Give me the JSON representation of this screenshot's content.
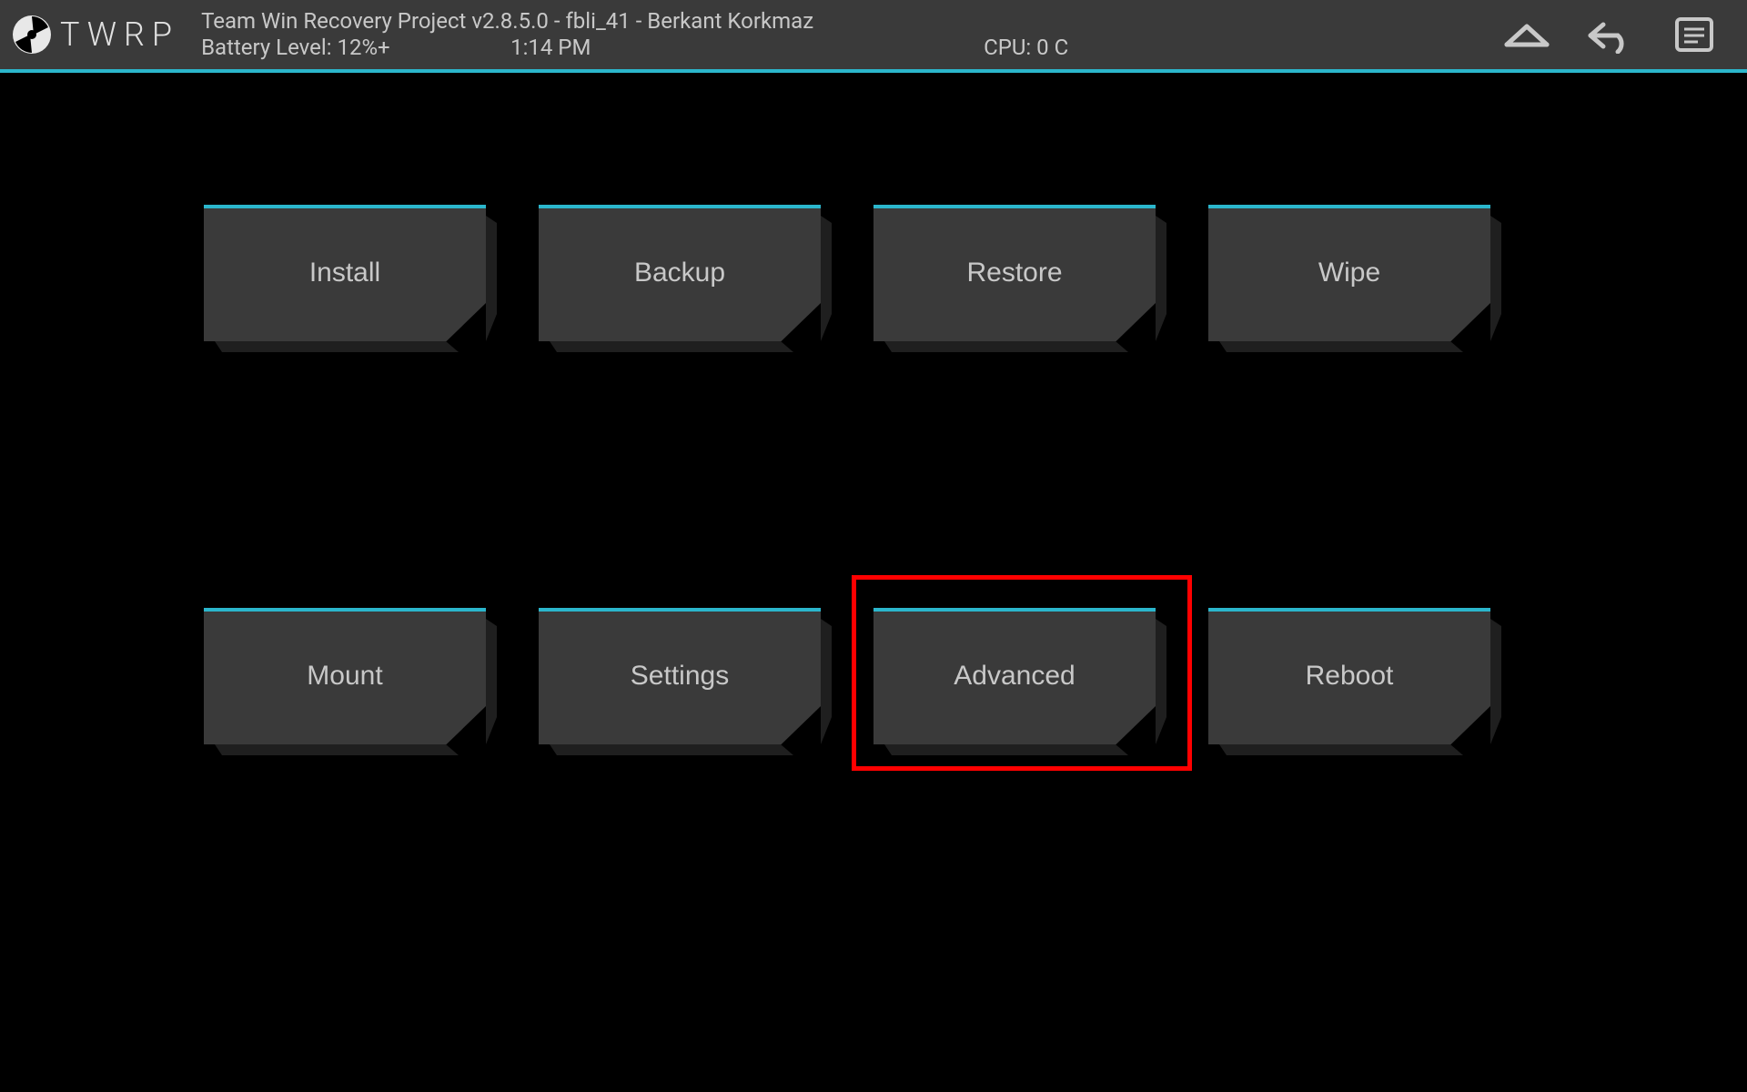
{
  "header": {
    "logo_text": "TWRP",
    "title_line": "Team Win Recovery Project  v2.8.5.0 - fbli_41 - Berkant Korkmaz",
    "battery": "Battery Level: 12%+",
    "time": "1:14 PM",
    "cpu": "CPU: 0 C"
  },
  "buttons": [
    {
      "label": "Install"
    },
    {
      "label": "Backup"
    },
    {
      "label": "Restore"
    },
    {
      "label": "Wipe"
    },
    {
      "label": "Mount"
    },
    {
      "label": "Settings"
    },
    {
      "label": "Advanced"
    },
    {
      "label": "Reboot"
    }
  ],
  "highlight": {
    "target_index": 6
  },
  "colors": {
    "accent": "#2bb6cc",
    "panel": "#3a3a3a",
    "text": "#c8c8c8",
    "highlight": "#ff0000"
  }
}
